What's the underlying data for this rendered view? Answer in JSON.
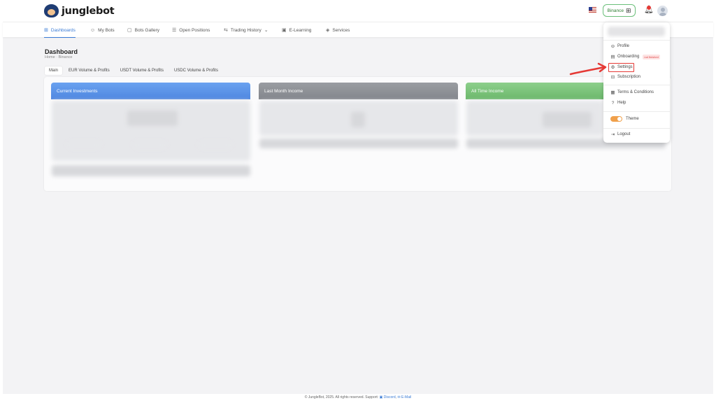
{
  "brand": {
    "name": "junglebot"
  },
  "header": {
    "exchange": "Binance"
  },
  "nav": [
    {
      "label": "Dashboards",
      "icon": "grid-icon"
    },
    {
      "label": "My Bots",
      "icon": "robot-icon"
    },
    {
      "label": "Bots Gallery",
      "icon": "bot-gallery-icon"
    },
    {
      "label": "Open Positions",
      "icon": "list-icon"
    },
    {
      "label": "Trading History",
      "icon": "history-icon"
    },
    {
      "label": "E-Learning",
      "icon": "book-icon"
    },
    {
      "label": "Services",
      "icon": "box-icon"
    }
  ],
  "page": {
    "title": "Dashboard",
    "breadcrumb": "Home  ·  Binance"
  },
  "tabs": [
    "Main",
    "EUR Volume & Profits",
    "USDT Volume & Profits",
    "USDC Volume & Profits"
  ],
  "cards": [
    {
      "title": "Current Investments",
      "color": "#5b92e6"
    },
    {
      "title": "Last Month Income",
      "color": "#8e9196"
    },
    {
      "title": "All Time Income",
      "color": "#79c279"
    }
  ],
  "user_menu": {
    "items": [
      {
        "label": "Profile",
        "icon": "user-circle-icon"
      },
      {
        "label": "Onboarding",
        "icon": "onboarding-icon",
        "badge": "not finished"
      },
      {
        "label": "Settings",
        "icon": "gear-icon"
      },
      {
        "label": "Subscription",
        "icon": "subscription-icon"
      },
      {
        "label": "Terms & Conditions",
        "icon": "document-icon"
      },
      {
        "label": "Help",
        "icon": "help-icon"
      },
      {
        "label": "Theme",
        "icon": "theme-toggle"
      },
      {
        "label": "Logout",
        "icon": "logout-icon"
      }
    ]
  },
  "footer": {
    "text": "© JungleBot, 2025. All rights reserved. Support:",
    "discord": "Discord",
    "email": "E-Mail"
  }
}
